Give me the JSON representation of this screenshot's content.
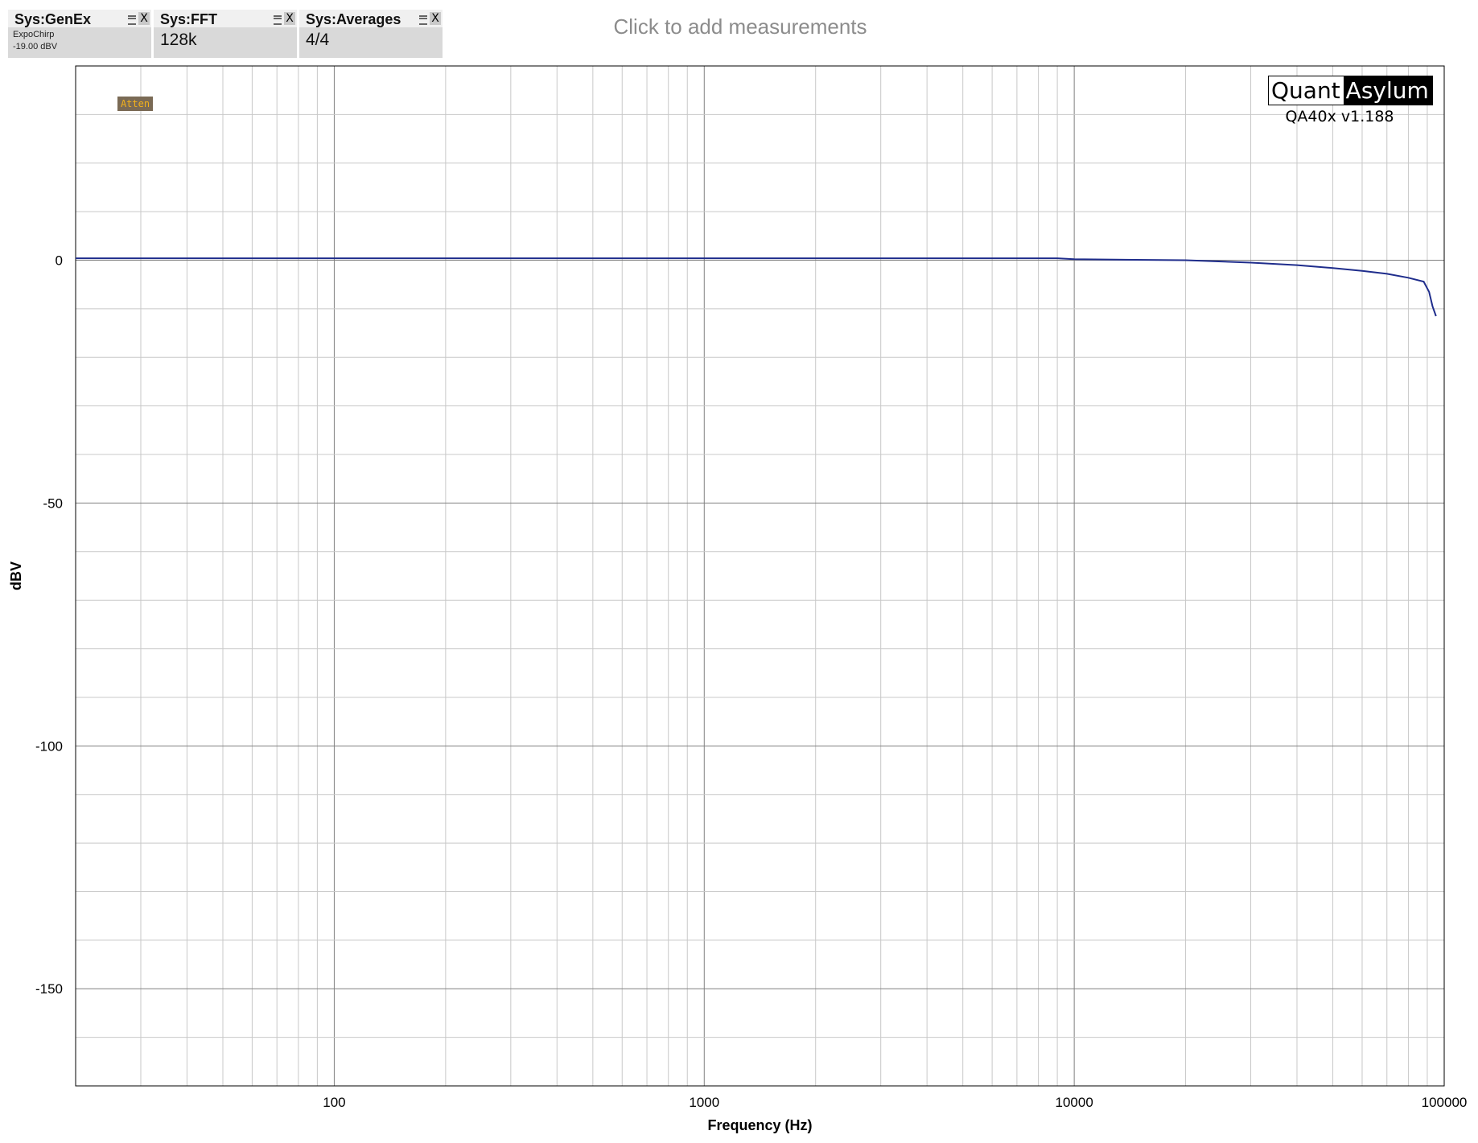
{
  "widgets": [
    {
      "title": "Sys:GenEx",
      "lines": [
        "ExpoChirp",
        "-19.00 dBV"
      ],
      "close": "X"
    },
    {
      "title": "Sys:FFT",
      "value": "128k",
      "close": "X"
    },
    {
      "title": "Sys:Averages",
      "value": "4/4",
      "close": "X"
    }
  ],
  "add_measurements": "Click to add measurements",
  "logo": {
    "part1": "Quant",
    "part2": "Asylum",
    "version": "QA40x v1.188"
  },
  "badge": "Atten",
  "colors": {
    "trace": "#1f2d8c",
    "grid": "#c8c8c8",
    "grid_major": "#808080"
  },
  "chart_data": {
    "type": "line",
    "title": "",
    "xlabel": "Frequency (Hz)",
    "ylabel": "dBV",
    "xscale": "log",
    "xlim": [
      20,
      100000
    ],
    "ylim": [
      -170,
      40
    ],
    "x_ticks": [
      100,
      1000,
      10000,
      100000
    ],
    "y_ticks": [
      0,
      -50,
      -100,
      -150
    ],
    "grid": true,
    "series": [
      {
        "x": [
          20,
          50,
          100,
          500,
          1000,
          5000,
          9000,
          10000,
          20000,
          30000,
          40000,
          50000,
          60000,
          70000,
          80000,
          88000,
          91000,
          93000,
          95000
        ],
        "y": [
          0.4,
          0.4,
          0.4,
          0.4,
          0.4,
          0.4,
          0.4,
          0.2,
          0.0,
          -0.5,
          -1.0,
          -1.6,
          -2.2,
          -2.8,
          -3.6,
          -4.4,
          -6.5,
          -9.5,
          -11.5
        ]
      }
    ]
  }
}
